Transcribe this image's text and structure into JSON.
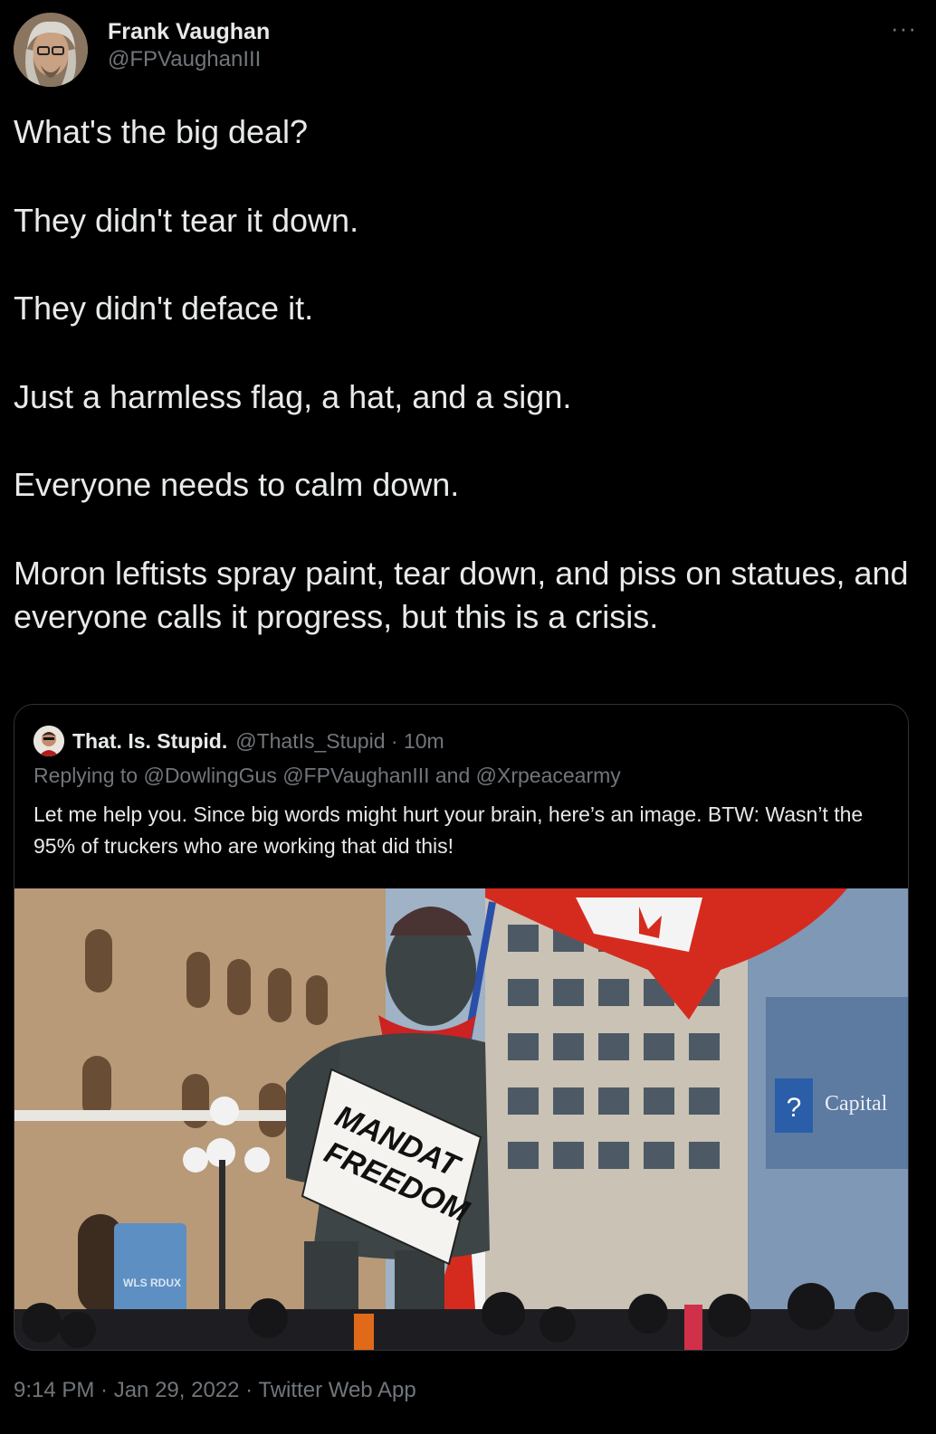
{
  "author": {
    "name": "Frank Vaughan",
    "handle": "@FPVaughanIII",
    "avatar_icon": "avatar-photo-icon"
  },
  "more_label": "···",
  "tweet_text": [
    "What's the big deal?",
    "They didn't tear it down.",
    "They didn't deface it.",
    "Just a harmless flag, a hat, and a sign.",
    "Everyone needs to calm down.",
    "Moron leftists spray paint, tear down, and piss on statues, and everyone calls it progress, but this is a crisis."
  ],
  "quoted": {
    "name": "That. Is. Stupid.",
    "handle_time": "@ThatIs_Stupid · 10m",
    "reply_prefix": "Replying to",
    "reply_to_1": "@DowlingGus",
    "reply_to_2": "@FPVaughanIII",
    "reply_and": "and",
    "reply_to_3": "@Xrpeacearmy",
    "text": "Let me help you. Since big words might hurt your brain, here’s an image. BTW: Wasn’t the 95% of truckers who are working that did this!",
    "image": {
      "sign_line1": "MANDAT",
      "sign_line2": "FREEDOM",
      "building_sign": "Capital",
      "kiosk_text": "WLS RDUX"
    }
  },
  "footer": {
    "meta": "9:14 PM · Jan 29, 2022 · Twitter Web App"
  },
  "colors": {
    "background": "#000000",
    "text": "#e7e9ea",
    "secondary": "#71767b",
    "border": "#2f3336",
    "flag_red": "#d52b1e"
  }
}
